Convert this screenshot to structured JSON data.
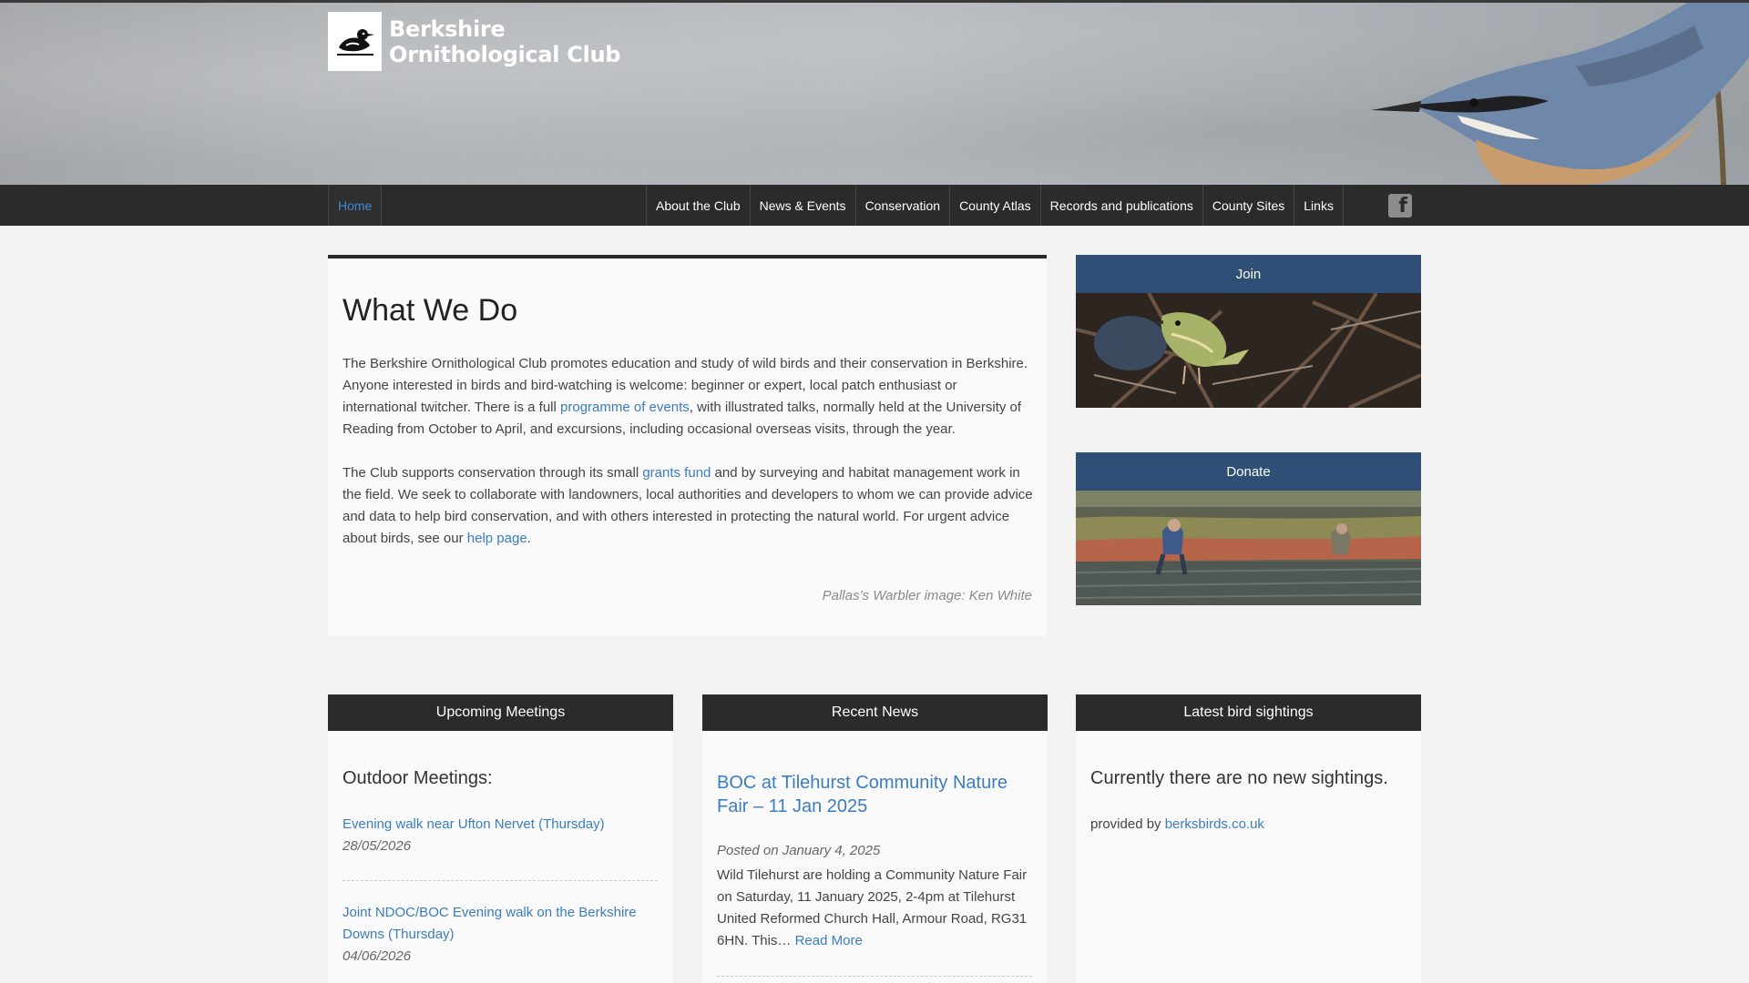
{
  "site": {
    "name_line1": "Berkshire",
    "name_line2": "Ornithological Club"
  },
  "nav": {
    "home": "Home",
    "items": [
      "About the Club",
      "News & Events",
      "Conservation",
      "County Atlas",
      "Records and publications",
      "County Sites",
      "Links"
    ],
    "facebook_icon": "f"
  },
  "article": {
    "title": "What We Do",
    "p1_a": "The Berkshire Ornithological Club promotes education and study of wild birds and their conservation in Berkshire. Anyone interested in birds and bird-watching is welcome: beginner or expert, local patch enthusiast or international twitcher. There is a full ",
    "p1_link": "programme of events",
    "p1_b": ", with illustrated talks, normally held  at the University of Reading from October to April, and excursions, including occasional overseas visits, through the year.",
    "p2_a": "The Club supports conservation through its small ",
    "p2_link": "grants fund",
    "p2_b": " and by surveying and habitat management work in the field. We seek to collaborate  with  landowners, local authorities and developers to whom we can provide advice and data to help bird conservation, and with others interested in protecting the natural world. For urgent advice about birds, see our ",
    "p2_link2": "help page",
    "p2_c": ".",
    "credit": "Pallas’s Warbler image: Ken White"
  },
  "widgets": {
    "join": "Join",
    "donate": "Donate"
  },
  "meetings": {
    "title": "Upcoming Meetings",
    "heading": "Outdoor Meetings:",
    "items": [
      {
        "name": "Evening walk near Ufton Nervet (Thursday)",
        "date": "28/05/2026"
      },
      {
        "name": "Joint NDOC/BOC Evening walk on the Berkshire Downs (Thursday)",
        "date": "04/06/2026"
      }
    ]
  },
  "news": {
    "title": "Recent News",
    "item_title": "BOC at Tilehurst Community Nature Fair – 11 Jan 2025",
    "meta": "Posted on January 4, 2025",
    "body": "Wild Tilehurst are holding a Community Nature Fair on Saturday, 11 January 2025, 2-4pm at Tilehurst United Reformed Church Hall, Armour Road, RG31 6HN. This… ",
    "read_more": "Read More"
  },
  "sightings": {
    "title": "Latest bird sightings",
    "message": "Currently there are no new sightings.",
    "provided_by": "provided by ",
    "link": "berksbirds.co.uk"
  },
  "colors": {
    "nav_bg": "#2b2b2b",
    "widget_blue": "#2f4f77",
    "link": "#3a7dc0"
  },
  "icons": [
    "logo-bird-icon",
    "facebook-icon"
  ]
}
